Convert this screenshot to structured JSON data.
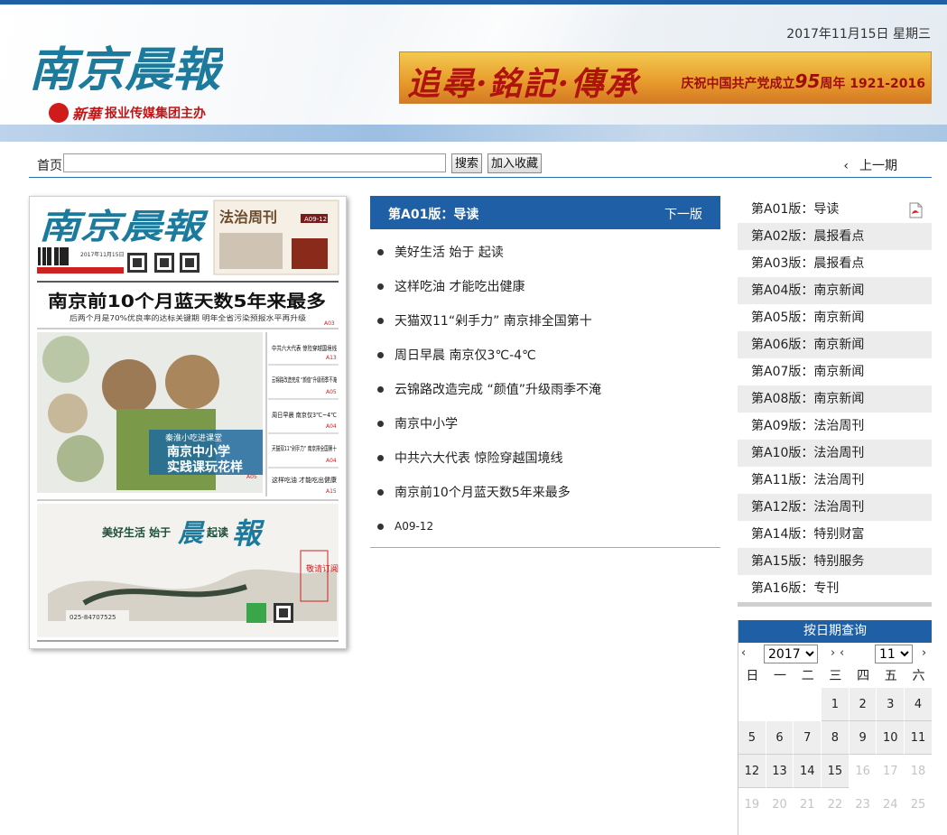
{
  "header": {
    "masthead": "南京晨報",
    "publisher_seal_text": "新華",
    "publisher_group": "报业传媒集团主办",
    "date": "2017年11月15日 星期三",
    "banner": {
      "calligraphy": "追尋·銘記·傳承",
      "slogan_prefix": "庆祝中国共产党成立",
      "slogan_number": "95",
      "slogan_suffix": "周年 1921-2016"
    }
  },
  "toolbar": {
    "home": "首页",
    "search_value": "",
    "search_button": "搜索",
    "bookmark_button": "加入收藏",
    "prev_chevron": "‹",
    "prev_issue": "上一期"
  },
  "front_page": {
    "masthead": "南京晨報",
    "supplement": "法治周刊",
    "supplement_pages": "A09-12",
    "issue_date": "2017年11月15日",
    "headline": "南京前10个月蓝天数5年来最多",
    "subheadline": "后两个月是70%优良率的达标关键期 明年全省污染预报水平再升级",
    "headline_page": "A03",
    "side_items": [
      {
        "text": "中共六大代表 惊险穿越国境线",
        "page": "A13"
      },
      {
        "text": "云锦路改造完成 “颜值”升级雨季不淹",
        "page": "A05"
      },
      {
        "text": "周日早晨 南京仅3℃~4℃",
        "page": "A04"
      },
      {
        "text": "天猫双11“剁手力” 南京排全国第十",
        "page": "A04"
      },
      {
        "text": "这样吃油 才能吃出健康",
        "page": "A15"
      }
    ],
    "photo_caption_small": "秦淮小吃进课堂",
    "photo_caption_line1": "南京中小学",
    "photo_caption_line2": "实践课玩花样",
    "photo_caption_page": "A05",
    "ad_slogan_a": "美好生活 始于",
    "ad_slogan_b": "晨",
    "ad_slogan_c": "起读",
    "ad_slogan_d": "報",
    "ad_vertical": "敬请订阅",
    "ad_phone": "025-84707525"
  },
  "edition": {
    "title": "第A01版：导读",
    "next": "下一版",
    "articles": [
      "美好生活 始于 起读",
      "这样吃油 才能吃出健康",
      "天猫双11“剁手力” 南京排全国第十",
      "周日早晨 南京仅3℃-4℃",
      "云锦路改造完成 “颜值”升级雨季不淹",
      "南京中小学",
      "中共六大代表 惊险穿越国境线",
      "南京前10个月蓝天数5年来最多",
      "A09-12"
    ]
  },
  "pages": [
    "第A01版：导读",
    "第A02版：晨报看点",
    "第A03版：晨报看点",
    "第A04版：南京新闻",
    "第A05版：南京新闻",
    "第A06版：南京新闻",
    "第A07版：南京新闻",
    "第A08版：南京新闻",
    "第A09版：法治周刊",
    "第A10版：法治周刊",
    "第A11版：法治周刊",
    "第A12版：法治周刊",
    "第A14版：特别财富",
    "第A15版：特别服务",
    "第A16版：专刊"
  ],
  "calendar": {
    "title": "按日期查询",
    "year": "2017",
    "month": "11",
    "prev_arrow": "‹",
    "next_arrow": "›",
    "weekdays": [
      "日",
      "一",
      "二",
      "三",
      "四",
      "五",
      "六"
    ],
    "weeks": [
      [
        "",
        "",
        "",
        "1",
        "2",
        "3",
        "4"
      ],
      [
        "5",
        "6",
        "7",
        "8",
        "9",
        "10",
        "11"
      ],
      [
        "12",
        "13",
        "14",
        "15",
        "16",
        "17",
        "18"
      ],
      [
        "19",
        "20",
        "21",
        "22",
        "23",
        "24",
        "25"
      ]
    ],
    "last_available_day": 15
  },
  "colors": {
    "brand_blue": "#1e5fa6",
    "masthead_teal": "#1c7a9c",
    "publisher_red": "#c21414"
  },
  "icons": {
    "pdf": "pdf-icon",
    "prev": "chevron-left-icon",
    "dot": "bullet-icon"
  }
}
